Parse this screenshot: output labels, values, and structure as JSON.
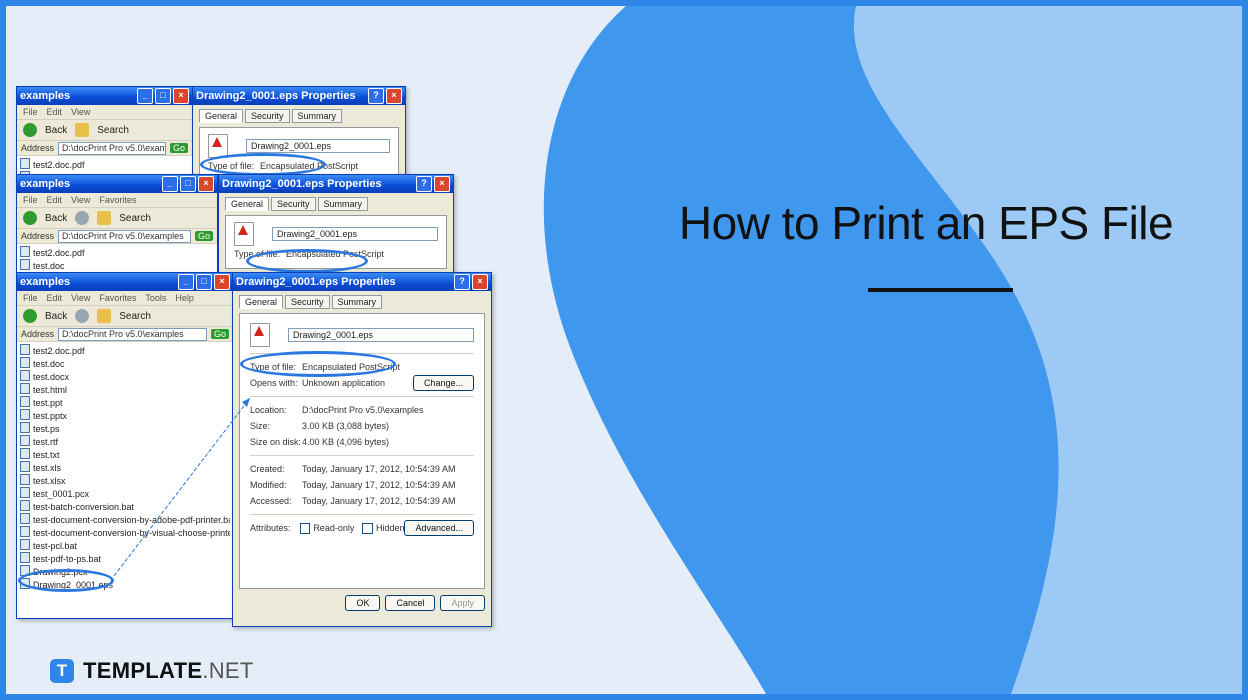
{
  "headline": "How to Print an EPS File",
  "brand": {
    "mark": "T",
    "name": "TEMPLATE",
    "suffix": ".NET"
  },
  "colors": {
    "frame": "#2f86e9",
    "background": "#e4edf8",
    "shape_dark": "#3f97ee",
    "shape_light": "#9ccaf5",
    "window_title": "#0b4cd6",
    "highlight": "#2b78e0"
  },
  "explorer": {
    "title": "examples",
    "menu": [
      "File",
      "Edit",
      "View",
      "Favorites",
      "Tools",
      "Help"
    ],
    "back_label": "Back",
    "search_label": "Search",
    "address_label": "Address",
    "address_value": "D:\\docPrint Pro v5.0\\examples",
    "go_label": "Go",
    "files": [
      "test2.doc.pdf",
      "test.doc",
      "test.docx",
      "test.html",
      "test.ppt",
      "test.pptx",
      "test.ps",
      "test.rtf",
      "test.txt",
      "test.xls",
      "test.xlsx",
      "test_0001.pcx",
      "test-batch-conversion.bat",
      "test-document-conversion-by-adobe-pdf-printer.bat",
      "test-document-conversion-by-visual-choose-printer.bat",
      "test-pcl.bat",
      "test-pdf-to-ps.bat",
      "Drawing2.pcx",
      "Drawing2_0001.eps"
    ]
  },
  "dialog": {
    "title": "Drawing2_0001.eps Properties",
    "tabs": [
      "General",
      "Security",
      "Summary"
    ],
    "filename": "Drawing2_0001.eps",
    "type_label": "Type of file:",
    "type_value": "Encapsulated PostScript",
    "opens_label": "Opens with:",
    "opens_value": "Unknown application",
    "change_label": "Change...",
    "location_label": "Location:",
    "location_value": "D:\\docPrint Pro v5.0\\examples",
    "size_label": "Size:",
    "size_value": "3.00 KB (3,088 bytes)",
    "disk_label": "Size on disk:",
    "disk_value": "4.00 KB (4,096 bytes)",
    "created_label": "Created:",
    "created_value": "Today, January 17, 2012, 10:54:39 AM",
    "modified_label": "Modified:",
    "modified_value": "Today, January 17, 2012, 10:54:39 AM",
    "accessed_label": "Accessed:",
    "accessed_value": "Today, January 17, 2012, 10:54:39 AM",
    "attributes_label": "Attributes:",
    "readonly_label": "Read-only",
    "hidden_label": "Hidden",
    "advanced_label": "Advanced...",
    "ok_label": "OK",
    "cancel_label": "Cancel",
    "apply_label": "Apply"
  }
}
